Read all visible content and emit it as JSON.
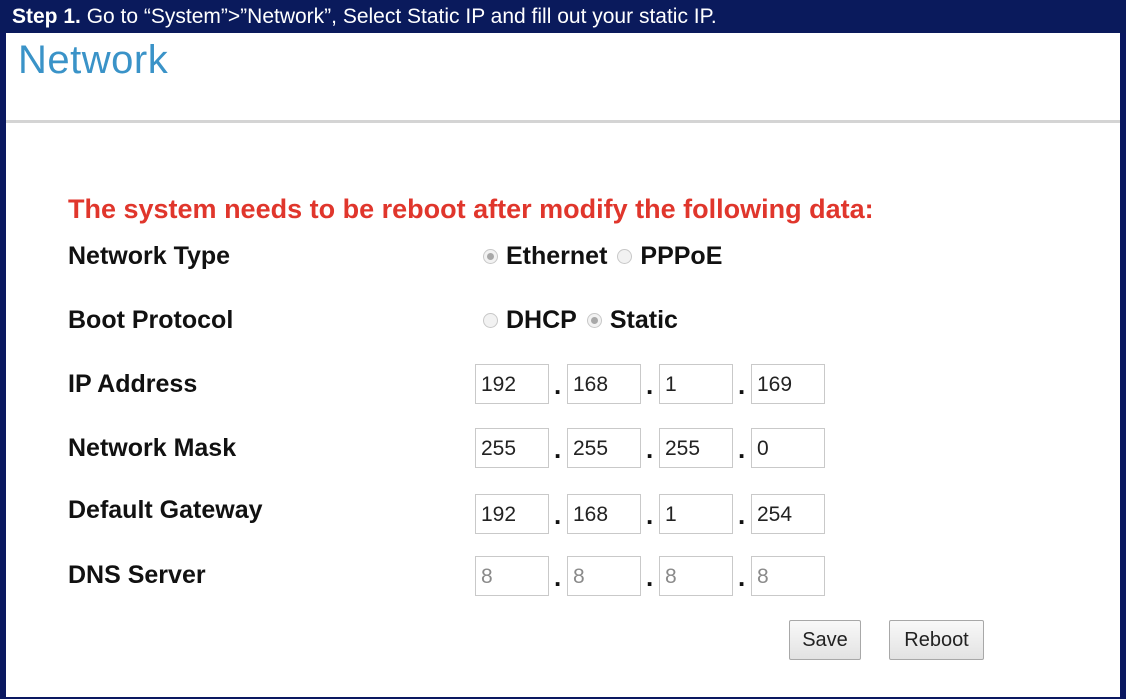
{
  "step_bar": {
    "step_label": "Step 1.",
    "instruction": "Go to “System”>”Network”, Select Static IP and fill out your static IP."
  },
  "page": {
    "title": "Network",
    "warning": "The system needs to be reboot after modify the following data:"
  },
  "network_type": {
    "label": "Network Type",
    "options": [
      {
        "label": "Ethernet",
        "checked": true
      },
      {
        "label": "PPPoE",
        "checked": false
      }
    ]
  },
  "boot_protocol": {
    "label": "Boot Protocol",
    "options": [
      {
        "label": "DHCP",
        "checked": false
      },
      {
        "label": "Static",
        "checked": true
      }
    ]
  },
  "ip_address": {
    "label": "IP Address",
    "octets": [
      "192",
      "168",
      "1",
      "169"
    ]
  },
  "network_mask": {
    "label": "Network Mask",
    "octets": [
      "255",
      "255",
      "255",
      "0"
    ]
  },
  "default_gateway": {
    "label": "Default Gateway",
    "octets": [
      "192",
      "168",
      "1",
      "254"
    ]
  },
  "dns_server": {
    "label": "DNS Server",
    "octets": [
      "8",
      "8",
      "8",
      "8"
    ]
  },
  "separator": ".",
  "buttons": {
    "save": "Save",
    "reboot": "Reboot"
  },
  "colors": {
    "step_bar_bg": "#0a1a5c",
    "title": "#3a93c8",
    "warning": "#e0362c"
  }
}
